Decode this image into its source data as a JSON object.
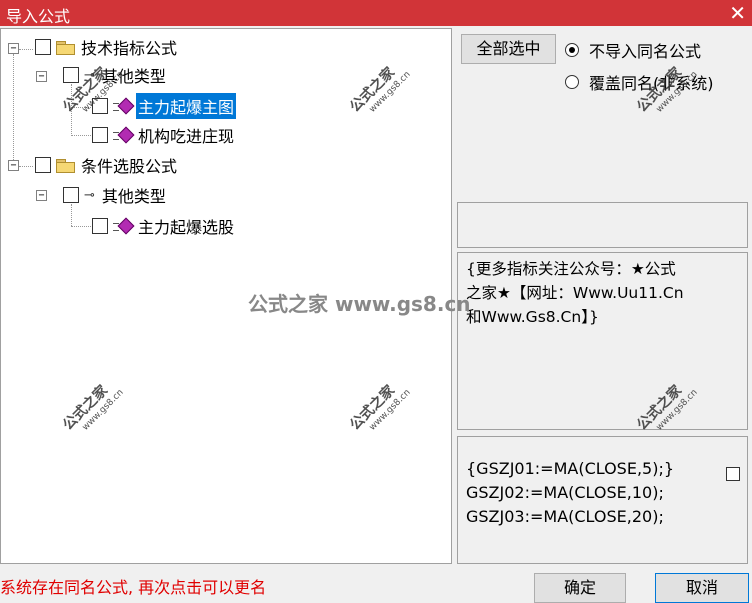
{
  "window": {
    "title": "导入公式",
    "close_glyph": "✕"
  },
  "tree": [
    {
      "id": "tech",
      "label": "技术指标公式",
      "icon": "folder-icon",
      "expander": "−"
    },
    {
      "id": "tech-other",
      "label": "其他类型",
      "icon": "key-icon",
      "expander": "−"
    },
    {
      "id": "tech-item1",
      "label": "主力起爆主图",
      "icon": "formula-gem-icon",
      "selected": true
    },
    {
      "id": "tech-item2",
      "label": "机构吃进庄现",
      "icon": "formula-gem-icon"
    },
    {
      "id": "select",
      "label": "条件选股公式",
      "icon": "folder-icon",
      "expander": "−"
    },
    {
      "id": "select-other",
      "label": "其他类型",
      "icon": "key-icon",
      "expander": "−"
    },
    {
      "id": "select-item1",
      "label": "主力起爆选股",
      "icon": "formula-gem-icon"
    }
  ],
  "buttons": {
    "select_all": "全部选中",
    "ok": "确定",
    "cancel": "取消"
  },
  "radios": [
    {
      "label": "不导入同名公式",
      "checked": true
    },
    {
      "label": "覆盖同名(非系统)",
      "checked": false
    }
  ],
  "description": [
    "{更多指标关注公众号：★公式",
    "之家★【网址：Www.Uu11.Cn",
    "和Www.Gs8.Cn】}"
  ],
  "code": [
    "{GSZJ01:=MA(CLOSE,5);}",
    "GSZJ02:=MA(CLOSE,10);",
    "GSZJ03:=MA(CLOSE,20);"
  ],
  "status": "系统存在同名公式, 再次点击可以更名",
  "watermark": {
    "title": "公式之家",
    "site": "www.gs8.cn",
    "big": "公式之家 www.gs8.cn"
  },
  "colors": {
    "titlebar": "#d13438",
    "selection": "#0078d7",
    "status": "#e00000"
  }
}
